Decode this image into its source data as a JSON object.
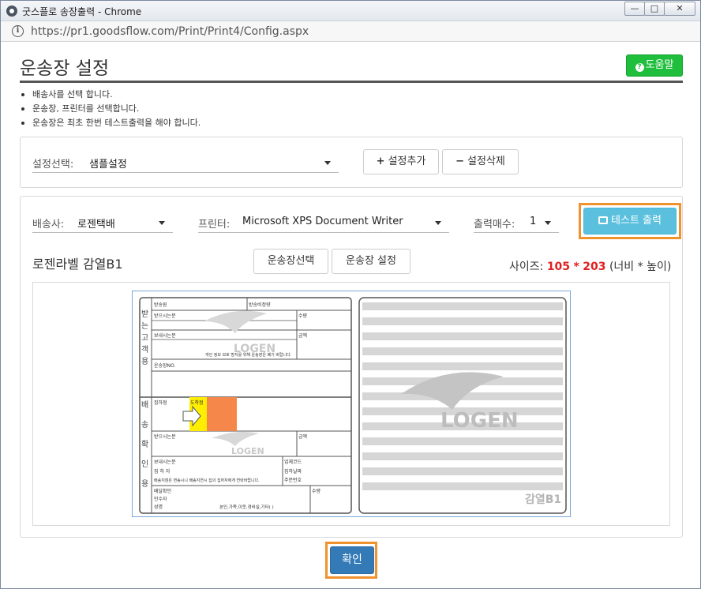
{
  "window": {
    "title": "굿스플로 송장출력 - Chrome",
    "url": "https://pr1.goodsflow.com/Print/Print4/Config.aspx",
    "min_label": "—",
    "max_label": "□",
    "close_label": "✕"
  },
  "header": {
    "title": "운송장 설정",
    "help_label": "도움말"
  },
  "instructions": [
    "배송사를 선택 합니다.",
    "운송장, 프린터를 선택합니다.",
    "운송장은 최초 한번 테스트출력을 해야 합니다."
  ],
  "settings": {
    "select_label": "설정선택:",
    "select_value": "샘플설정",
    "add_label": "설정추가",
    "delete_label": "설정삭제"
  },
  "main": {
    "carrier_label": "배송사:",
    "carrier_value": "로젠택배",
    "printer_label": "프린터:",
    "printer_value": "Microsoft XPS Document Writer",
    "copies_label": "출력매수:",
    "copies_value": "1",
    "test_print_label": "테스트 출력",
    "label_name": "로젠라벨 감열B1",
    "waybill_select_label": "운송장선택",
    "waybill_settings_label": "운송장 설정",
    "size_prefix": "사이즈:",
    "size_width": "105",
    "size_times": "*",
    "size_height": "203",
    "size_suffix": "(너비 * 높이)"
  },
  "preview": {
    "left_rows": [
      "받송원",
      "받송비정량",
      "받으시는분",
      "수량",
      "보내시는분",
      "금액",
      "운송장NO.",
      "집하점",
      "도착점",
      "받으시는분",
      "금액",
      "보내시는분",
      "업체코드",
      "집 하 자",
      "집하날짜",
      "주문번호",
      "배달확인",
      "인수자",
      "성명",
      "수량",
      "본인,가족,이웃,경비실,기타(          )"
    ],
    "side_top": [
      "받",
      "는",
      "고",
      "객",
      "용"
    ],
    "side_bottom": [
      "배",
      "송",
      "확",
      "인",
      "용"
    ],
    "notice": "개인 정보 보호 방지를 위해 운송장은 폐기 바랍니다.",
    "store_notice": "배송지점은 변송시니 배송지연시 집의 집하자에게 연락바랍니다.",
    "brand": "LOGEN",
    "right_tag": "감열B1"
  },
  "footer": {
    "confirm_label": "확인"
  },
  "colors": {
    "help_green": "#1fbe3c",
    "test_print_blue": "#5bc0de",
    "confirm_blue": "#337ab7",
    "highlight_orange": "#f0922e",
    "size_red": "#e02020"
  }
}
